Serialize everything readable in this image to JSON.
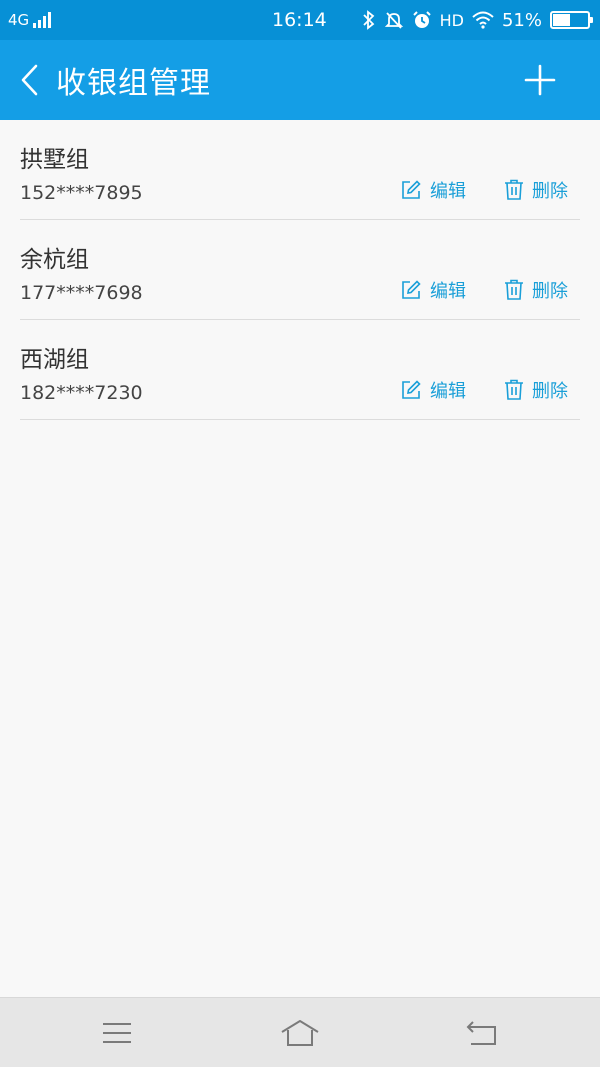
{
  "status_bar": {
    "network": "4G",
    "time": "16:14",
    "hd": "HD",
    "battery": "51%",
    "battery_level": 0.51,
    "icons": [
      "signal-icon",
      "bluetooth-icon",
      "mute-alarm-icon",
      "alarm-clock-icon",
      "wifi-icon",
      "battery-icon"
    ]
  },
  "header": {
    "title": "收银组管理",
    "back_icon": "chevron-left-icon",
    "add_icon": "plus-icon"
  },
  "actions": {
    "edit_label": "编辑",
    "delete_label": "删除",
    "edit_icon": "pencil-square-icon",
    "delete_icon": "trash-icon"
  },
  "groups": [
    {
      "name": "拱墅组",
      "phone": "152****7895"
    },
    {
      "name": "余杭组",
      "phone": "177****7698"
    },
    {
      "name": "西湖组",
      "phone": "182****7230"
    }
  ],
  "nav_bar": {
    "icons": [
      "menu-icon",
      "home-icon",
      "back-icon"
    ]
  },
  "colors": {
    "status_bar": "#0790d6",
    "app_bar": "#149ee6",
    "accent": "#1a9fd8",
    "background": "#f8f8f8"
  }
}
